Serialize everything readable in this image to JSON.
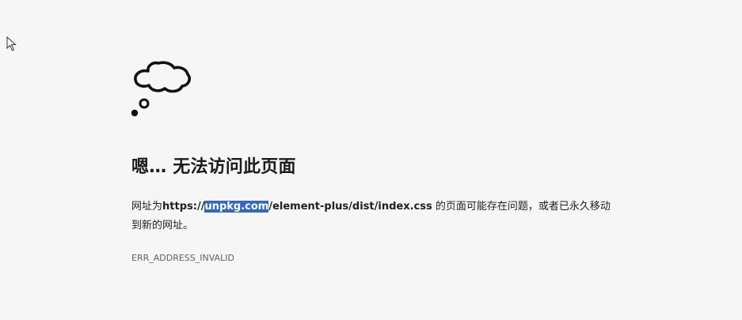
{
  "error_page": {
    "title": "嗯… 无法访问此页面",
    "message_prefix": "网址为",
    "url_scheme": "https://",
    "url_host_selected": "unpkg.com",
    "url_path": "/element-plus/dist/index.css",
    "message_suffix": " 的页面可能存在问题，或者已永久移动到新的网址。",
    "error_code": "ERR_ADDRESS_INVALID",
    "icon": "thought-cloud-icon"
  },
  "colors": {
    "background": "#f6f6f6",
    "selection": "#3367c4",
    "text": "#202124",
    "code_text": "#5f6368"
  }
}
